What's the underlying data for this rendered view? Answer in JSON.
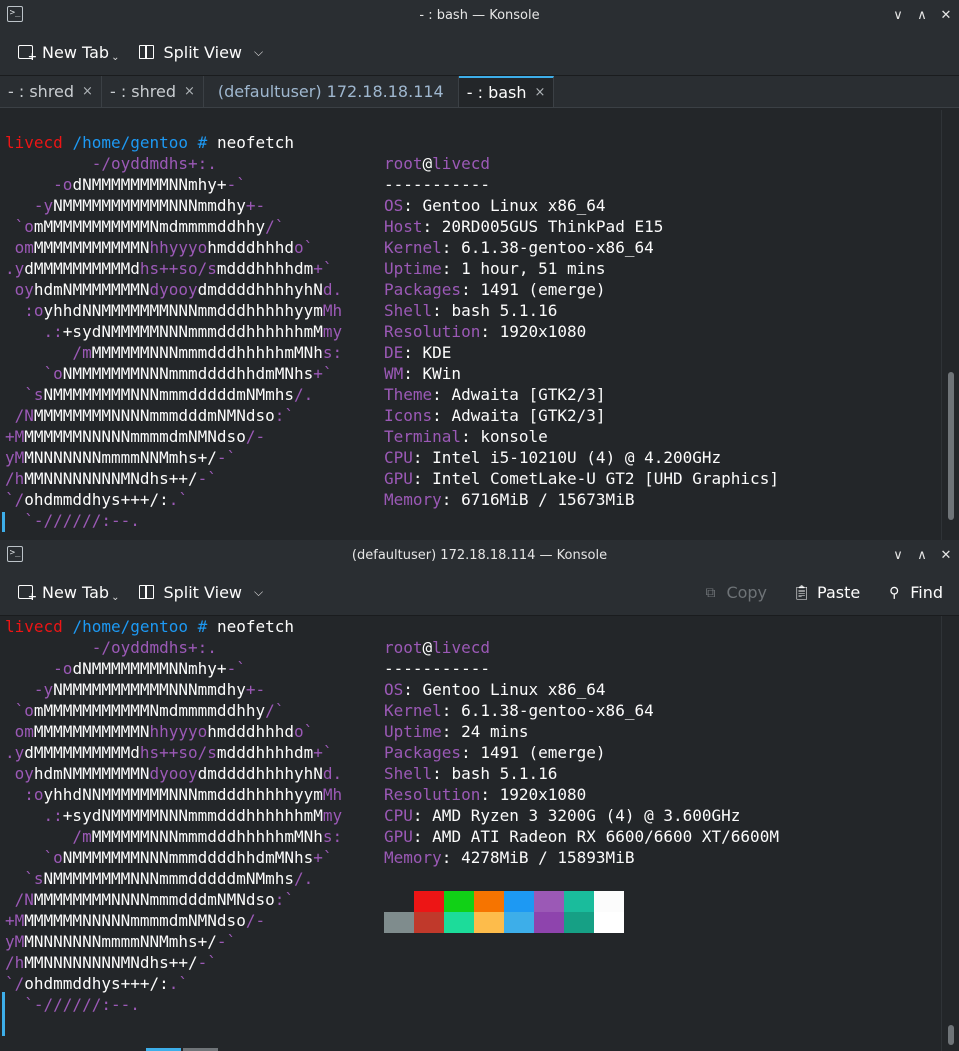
{
  "windows": [
    {
      "title": "- : bash — Konsole",
      "toolbar": {
        "new_tab": "New Tab",
        "split_view": "Split View"
      },
      "tabs": [
        {
          "label": "- : shred",
          "close": "×"
        },
        {
          "label": "- : shred",
          "close": "×"
        },
        {
          "label": "(defaultuser) 172.18.18.114",
          "close": ""
        },
        {
          "label": "- : bash",
          "close": "×"
        }
      ],
      "prompt": {
        "host": "livecd",
        "path": "/home/gentoo",
        "symbol": "#",
        "command": "neofetch"
      },
      "info": [
        {
          "key": "",
          "val": "root@livecd"
        },
        {
          "key": "",
          "val": "-----------"
        },
        {
          "key": "OS",
          "val": "Gentoo Linux x86_64"
        },
        {
          "key": "Host",
          "val": "20RD005GUS ThinkPad E15"
        },
        {
          "key": "Kernel",
          "val": "6.1.38-gentoo-x86_64"
        },
        {
          "key": "Uptime",
          "val": "1 hour, 51 mins"
        },
        {
          "key": "Packages",
          "val": "1491 (emerge)"
        },
        {
          "key": "Shell",
          "val": "bash 5.1.16"
        },
        {
          "key": "Resolution",
          "val": "1920x1080"
        },
        {
          "key": "DE",
          "val": "KDE"
        },
        {
          "key": "WM",
          "val": "KWin"
        },
        {
          "key": "Theme",
          "val": "Adwaita [GTK2/3]"
        },
        {
          "key": "Icons",
          "val": "Adwaita [GTK2/3]"
        },
        {
          "key": "Terminal",
          "val": "konsole"
        },
        {
          "key": "CPU",
          "val": "Intel i5-10210U (4) @ 4.200GHz"
        },
        {
          "key": "GPU",
          "val": "Intel CometLake-U GT2 [UHD Graphics]"
        },
        {
          "key": "Memory",
          "val": "6716MiB / 15673MiB"
        }
      ]
    },
    {
      "title": "(defaultuser) 172.18.18.114 — Konsole",
      "toolbar": {
        "new_tab": "New Tab",
        "split_view": "Split View",
        "copy": "Copy",
        "paste": "Paste",
        "find": "Find"
      },
      "prompt": {
        "host": "livecd",
        "path": "/home/gentoo",
        "symbol": "#",
        "command": "neofetch"
      },
      "info": [
        {
          "key": "",
          "val": "root@livecd"
        },
        {
          "key": "",
          "val": "-----------"
        },
        {
          "key": "OS",
          "val": "Gentoo Linux x86_64"
        },
        {
          "key": "Kernel",
          "val": "6.1.38-gentoo-x86_64"
        },
        {
          "key": "Uptime",
          "val": "24 mins"
        },
        {
          "key": "Packages",
          "val": "1491 (emerge)"
        },
        {
          "key": "Shell",
          "val": "bash 5.1.16"
        },
        {
          "key": "Resolution",
          "val": "1920x1080"
        },
        {
          "key": "CPU",
          "val": "AMD Ryzen 3 3200G (4) @ 3.600GHz"
        },
        {
          "key": "GPU",
          "val": "AMD ATI Radeon RX 6600/6600 XT/6600M"
        },
        {
          "key": "Memory",
          "val": "4278MiB / 15893MiB"
        }
      ],
      "palette": {
        "row1": [
          "#232629",
          "#ed1515",
          "#11d116",
          "#f67400",
          "#1d99f3",
          "#9b59b6",
          "#1abc9c",
          "#fcfcfc"
        ],
        "row2": [
          "#7f8c8d",
          "#c0392b",
          "#1cdc9a",
          "#fdbc4b",
          "#3daee9",
          "#8e44ad",
          "#16a085",
          "#ffffff"
        ]
      }
    }
  ],
  "logo": [
    [
      [
        "mag",
        "         -/oyddmdhs+:."
      ]
    ],
    [
      [
        "mag",
        "     -o"
      ],
      [
        "wh",
        "dNMMMMMMMMNNmhy+"
      ],
      [
        "mag",
        "-`"
      ]
    ],
    [
      [
        "mag",
        "   -y"
      ],
      [
        "wh",
        "NMMMMMMMMMMMNNNmmdhy"
      ],
      [
        "mag",
        "+-"
      ]
    ],
    [
      [
        "mag",
        " `o"
      ],
      [
        "wh",
        "mMMMMMMMMMMMNmdmmmmddhhy"
      ],
      [
        "mag",
        "/`"
      ]
    ],
    [
      [
        "mag",
        " om"
      ],
      [
        "wh",
        "MMMMMMMMMMMN"
      ],
      [
        "mag",
        "hhyyyo"
      ],
      [
        "wh",
        "hmdddhhhd"
      ],
      [
        "mag",
        "o`"
      ]
    ],
    [
      [
        "mag",
        ".y"
      ],
      [
        "wh",
        "dMMMMMMMMMMd"
      ],
      [
        "mag",
        "hs++so/s"
      ],
      [
        "wh",
        "mdddhhhhdm"
      ],
      [
        "mag",
        "+`"
      ]
    ],
    [
      [
        "mag",
        " oy"
      ],
      [
        "wh",
        "hdmNMMMMMMMN"
      ],
      [
        "mag",
        "dyooy"
      ],
      [
        "wh",
        "dmddddhhhhyhN"
      ],
      [
        "mag",
        "d."
      ]
    ],
    [
      [
        "mag",
        "  :o"
      ],
      [
        "wh",
        "yhhdNNMMMMMMMNNNmmdddhhhhhyym"
      ],
      [
        "mag",
        "Mh"
      ]
    ],
    [
      [
        "mag",
        "    .:"
      ],
      [
        "wh",
        "+sydNMMMMMNNNmmmdddhhhhhhmM"
      ],
      [
        "mag",
        "my"
      ]
    ],
    [
      [
        "mag",
        "       /m"
      ],
      [
        "wh",
        "MMMMMMNNNmmmdddhhhhhmMNh"
      ],
      [
        "mag",
        "s:"
      ]
    ],
    [
      [
        "mag",
        "    `o"
      ],
      [
        "wh",
        "NMMMMMMMNNNmmmddddhhdmMNhs"
      ],
      [
        "mag",
        "+`"
      ]
    ],
    [
      [
        "mag",
        "  `s"
      ],
      [
        "wh",
        "NMMMMMMMMNNNmmmdddddmNMmhs"
      ],
      [
        "mag",
        "/."
      ]
    ],
    [
      [
        "mag",
        " /N"
      ],
      [
        "wh",
        "MMMMMMMMNNNNmmmdddmNMNdso"
      ],
      [
        "mag",
        ":`"
      ]
    ],
    [
      [
        "mag",
        "+M"
      ],
      [
        "wh",
        "MMMMMMNNNNNmmmmdmNMNdso"
      ],
      [
        "mag",
        "/-"
      ]
    ],
    [
      [
        "mag",
        "yM"
      ],
      [
        "wh",
        "MNNNNNNNmmmmNNMmhs+/"
      ],
      [
        "mag",
        "-`"
      ]
    ],
    [
      [
        "mag",
        "/h"
      ],
      [
        "wh",
        "MMNNNNNNNNMNdhs++/"
      ],
      [
        "mag",
        "-`"
      ]
    ],
    [
      [
        "mag",
        "`/"
      ],
      [
        "wh",
        "ohdmmddhys+++/:"
      ],
      [
        "mag",
        ".`"
      ]
    ],
    [
      [
        "mag",
        "  `-//////:--."
      ]
    ]
  ]
}
